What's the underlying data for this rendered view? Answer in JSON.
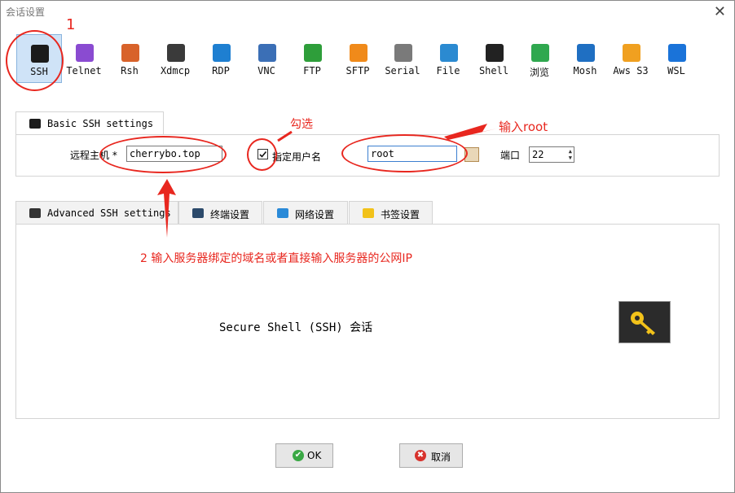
{
  "window": {
    "title": "会话设置",
    "close_glyph": "✕"
  },
  "protocols": [
    {
      "label": "SSH",
      "icon": "key-icon",
      "color": "#1b1b1b"
    },
    {
      "label": "Telnet",
      "icon": "telnet-icon",
      "color": "#8a4bd1"
    },
    {
      "label": "Rsh",
      "icon": "rsh-icon",
      "color": "#d8622a"
    },
    {
      "label": "Xdmcp",
      "icon": "xdmcp-icon",
      "color": "#3a3a3a"
    },
    {
      "label": "RDP",
      "icon": "rdp-icon",
      "color": "#1e7fd1"
    },
    {
      "label": "VNC",
      "icon": "vnc-icon",
      "color": "#3b6fb6"
    },
    {
      "label": "FTP",
      "icon": "ftp-icon",
      "color": "#2e9e3a"
    },
    {
      "label": "SFTP",
      "icon": "sftp-icon",
      "color": "#f08a1a"
    },
    {
      "label": "Serial",
      "icon": "serial-icon",
      "color": "#7a7a7a"
    },
    {
      "label": "File",
      "icon": "file-icon",
      "color": "#2b8ad1"
    },
    {
      "label": "Shell",
      "icon": "shell-icon",
      "color": "#222222"
    },
    {
      "label": "浏览",
      "icon": "browser-icon",
      "color": "#2fa84f"
    },
    {
      "label": "Mosh",
      "icon": "mosh-icon",
      "color": "#1f6fc2"
    },
    {
      "label": "Aws S3",
      "icon": "aws-s3-icon",
      "color": "#f0a020"
    },
    {
      "label": "WSL",
      "icon": "wsl-icon",
      "color": "#1a73d9"
    }
  ],
  "basic": {
    "tab_label": "Basic SSH settings",
    "remote_host_label": "远程主机 *",
    "remote_host_value": "cherrybo.top",
    "specify_user_checked": true,
    "specify_user_label": "指定用户名",
    "username_value": "root",
    "port_label": "端口",
    "port_value": "22"
  },
  "lower_tabs": [
    {
      "label": "Advanced SSH settings",
      "icon": "key-icon",
      "color": "#333333"
    },
    {
      "label": "终端设置",
      "icon": "terminal-icon",
      "color": "#2c4a6b"
    },
    {
      "label": "网络设置",
      "icon": "network-icon",
      "color": "#2a8ad8"
    },
    {
      "label": "书签设置",
      "icon": "star-icon",
      "color": "#f2c21a"
    }
  ],
  "session_text": "Secure Shell (SSH) 会话",
  "buttons": {
    "ok": "OK",
    "cancel": "取消"
  },
  "annotations": {
    "step1": "1",
    "check": "勾选",
    "root": "输入root",
    "step2": "2 输入服务器绑定的域名或者直接输入服务器的公网IP"
  },
  "colors": {
    "annotation": "#e8271f",
    "selected": "#cfe3f7",
    "key_bg": "#2b2b2b",
    "key_fg": "#f2c21a",
    "ok": "#3aa845",
    "cancel": "#d8322c"
  }
}
